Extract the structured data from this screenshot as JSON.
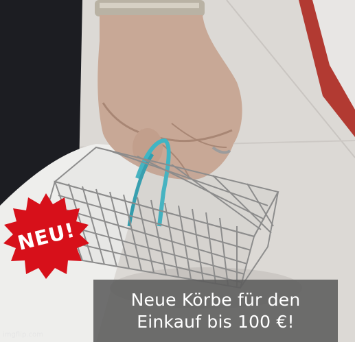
{
  "badge": {
    "text": "NEU!",
    "color": "#d7101a"
  },
  "caption": {
    "line1": "Neue Körbe für den",
    "line2": "Einkauf bis 100 €!"
  },
  "watermark": "imgflip.com",
  "colors": {
    "caption_background": "#5c5c5c",
    "handle_color": "#3fb5c4",
    "floor": "#d8d5d1"
  }
}
